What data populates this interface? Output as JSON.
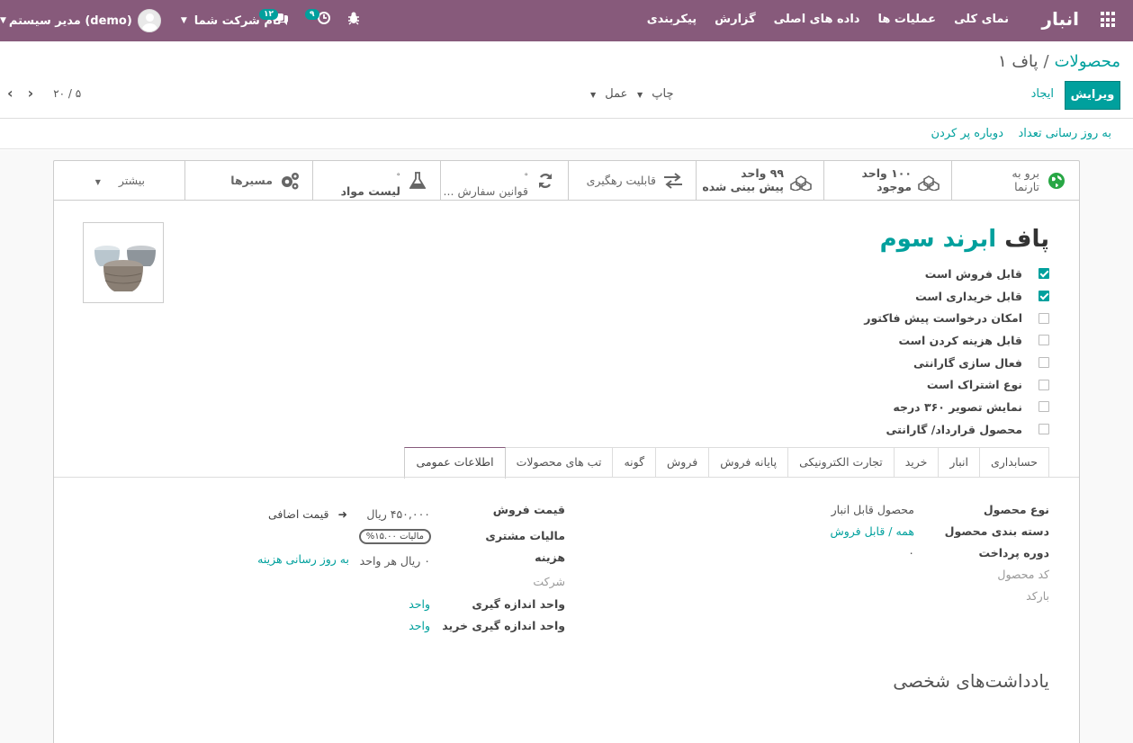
{
  "navbar": {
    "brand": "انبار",
    "menu": [
      "نمای کلی",
      "عملیات ها",
      "داده های اصلی",
      "گزارش",
      "پیکربندی"
    ],
    "activity_count": "۹",
    "messages_count": "۱۲",
    "company": "نام شرکت شما",
    "user": "مدیر سیستم (demo)"
  },
  "breadcrumb": {
    "parent": "محصولات",
    "current": "پاف ۱"
  },
  "controls": {
    "edit": "ویرایش",
    "create": "ایجاد",
    "print": "چاپ",
    "action": "عمل",
    "pager": "۵ / ۲۰"
  },
  "statusbar": {
    "update_qty": "به روز رسانی تعداد",
    "replenish": "دوباره پر کردن"
  },
  "smart_buttons": {
    "website": [
      "برو به",
      "تارنما"
    ],
    "on_hand": [
      "۱۰۰ واحد",
      "موجود"
    ],
    "forecast": [
      "۹۹ واحد",
      "پیش بینی شده"
    ],
    "traceability": "قابلیت رهگیری",
    "reorder": "قوانین سفارش ...",
    "bom": "لیست مواد",
    "routes": "مسیرها",
    "more": "بیشتر"
  },
  "product": {
    "name_part1": "پاف",
    "name_part2": "ابرند سوم",
    "checks": [
      {
        "label": "قابل فروش است",
        "checked": true
      },
      {
        "label": "قابل خریداری است",
        "checked": true
      },
      {
        "label": "امکان درخواست پیش فاکتور",
        "checked": false
      },
      {
        "label": "قابل هزینه کردن است",
        "checked": false
      },
      {
        "label": "فعال سازی گارانتی",
        "checked": false
      },
      {
        "label": "نوع اشتراک است",
        "checked": false
      },
      {
        "label": "نمایش تصویر ۳۶۰ درجه",
        "checked": false
      },
      {
        "label": "محصول قرارداد/ گارانتی",
        "checked": false
      }
    ]
  },
  "tabs": [
    "اطلاعات عمومی",
    "تب های محصولات",
    "گونه",
    "فروش",
    "پایانه فروش",
    "تجارت الکترونیکی",
    "خرید",
    "انبار",
    "حسابداری"
  ],
  "general": {
    "product_type_label": "نوع محصول",
    "product_type": "محصول قابل انبار",
    "category_label": "دسته بندی محصول",
    "category": "همه / قابل فروش",
    "payment_period_label": "دوره پرداخت",
    "payment_period": "۰",
    "ref_label": "کد محصول",
    "barcode_label": "بارکد",
    "sale_price_label": "قیمت فروش",
    "sale_price": "۴۵۰,۰۰۰ ریال",
    "extra_price": "قیمت اضافی",
    "customer_tax_label": "مالیات مشتری",
    "customer_tax": "مالیات ۱۵.۰۰%",
    "cost_label": "هزینه",
    "cost": "۰ ریال هر واحد",
    "update_cost": "به روز رسانی هزینه",
    "company_label": "شرکت",
    "uom_label": "واحد اندازه گیری",
    "uom": "واحد",
    "purchase_uom_label": "واحد اندازه گیری خرید",
    "purchase_uom": "واحد"
  },
  "notes_title": "یادداشت‌های شخصی",
  "colors": {
    "primary": "#875a7b",
    "accent": "#00a09d"
  }
}
